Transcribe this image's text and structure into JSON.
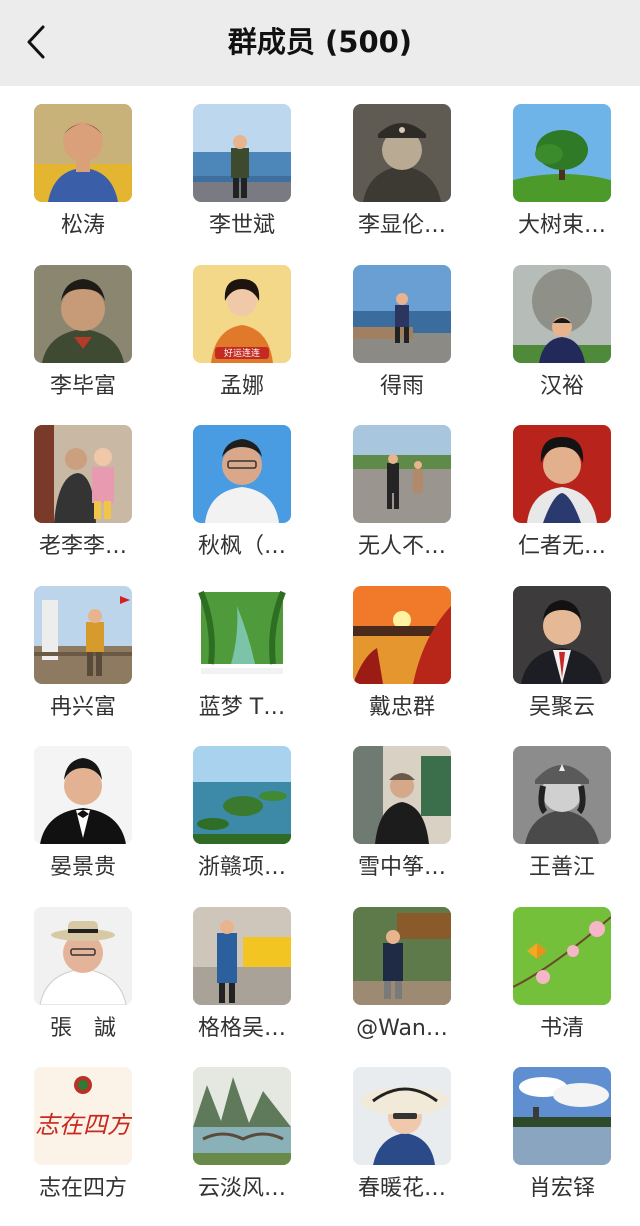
{
  "header": {
    "back_icon": "chevron-left-icon",
    "title": "群成员 (500)"
  },
  "members": [
    {
      "name": "松涛",
      "avatar": "man-portrait-blue-shirt"
    },
    {
      "name": "李世斌",
      "avatar": "man-at-seaside-promenade"
    },
    {
      "name": "李显伦…",
      "avatar": "sepia-soldier-portrait"
    },
    {
      "name": "大树束…",
      "avatar": "green-tree-on-hill"
    },
    {
      "name": "李毕富",
      "avatar": "vintage-young-man-portrait"
    },
    {
      "name": "孟娜",
      "avatar": "woman-in-qipao-with-sign"
    },
    {
      "name": "得雨",
      "avatar": "person-at-sea-pier"
    },
    {
      "name": "汉裕",
      "avatar": "man-before-stone-statue"
    },
    {
      "name": "老李李…",
      "avatar": "grandfather-with-child"
    },
    {
      "name": "秋枫（…",
      "avatar": "man-id-photo-blue-background"
    },
    {
      "name": "无人不…",
      "avatar": "people-walking-on-road"
    },
    {
      "name": "仁者无…",
      "avatar": "man-portrait-red-background"
    },
    {
      "name": "冉兴富",
      "avatar": "man-at-monument-railing"
    },
    {
      "name": "蓝梦 T…",
      "avatar": "willow-river-landscape"
    },
    {
      "name": "戴忠群",
      "avatar": "sunset-over-lake-red-leaves"
    },
    {
      "name": "吴聚云",
      "avatar": "man-in-suit-dark-background"
    },
    {
      "name": "晏景贵",
      "avatar": "man-in-tuxedo-white-background"
    },
    {
      "name": "浙赣项…",
      "avatar": "lake-islands-aerial-view"
    },
    {
      "name": "雪中筝…",
      "avatar": "man-in-cap-outdoors"
    },
    {
      "name": "王善江",
      "avatar": "bw-woman-in-military-cap"
    },
    {
      "name": "張　誠",
      "avatar": "man-in-hat-smiling"
    },
    {
      "name": "格格吴…",
      "avatar": "woman-standing-indoors"
    },
    {
      "name": "@Wan…",
      "avatar": "man-at-scenic-gate"
    },
    {
      "name": "书清",
      "avatar": "butterfly-and-flowers"
    },
    {
      "name": "志在四方",
      "avatar": "calligraphy-with-emblem"
    },
    {
      "name": "云淡风…",
      "avatar": "mountain-river-bridge-painting"
    },
    {
      "name": "春暖花…",
      "avatar": "woman-in-sun-hat"
    },
    {
      "name": "肖宏铎",
      "avatar": "lake-with-pagoda-clouds"
    }
  ]
}
